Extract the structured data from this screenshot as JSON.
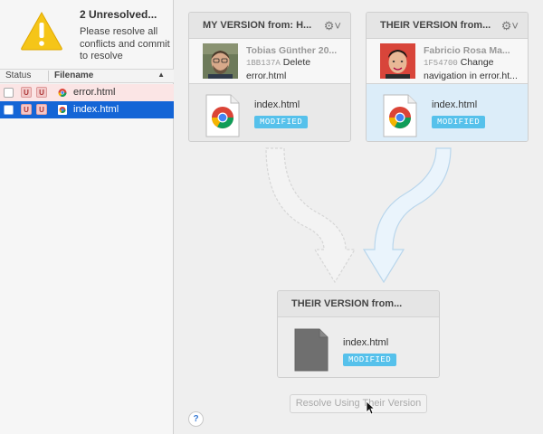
{
  "sidebar": {
    "warning": {
      "title": "2 Unresolved...",
      "message": "Please resolve all conflicts and commit to resolve"
    },
    "table": {
      "status_header": "Status",
      "filename_header": "Filename",
      "rows": [
        {
          "badge1": "U",
          "badge2": "U",
          "filename": "error.html",
          "selected": false
        },
        {
          "badge1": "U",
          "badge2": "U",
          "filename": "index.html",
          "selected": true
        }
      ]
    }
  },
  "main": {
    "my_version": {
      "title": "MY VERSION from: H...",
      "author": "Tobias Günther  20...",
      "hash": "1BB137A",
      "message": "Delete error.html",
      "filename": "index.html",
      "status": "MODIFIED"
    },
    "their_version": {
      "title": "THEIR VERSION from...",
      "author": "Fabricio Rosa Ma...",
      "hash": "1F54700",
      "message": "Change navigation in error.ht...",
      "filename": "index.html",
      "status": "MODIFIED"
    },
    "result": {
      "title": "THEIR VERSION from...",
      "filename": "index.html",
      "status": "MODIFIED"
    },
    "resolve_button": "Resolve Using Their Version",
    "help_button": "?"
  },
  "colors": {
    "selection": "#1465d6",
    "modified_badge": "#56c1eb",
    "conflict_badge": "#f2c9c9",
    "their_highlight": "#dcedf9"
  }
}
